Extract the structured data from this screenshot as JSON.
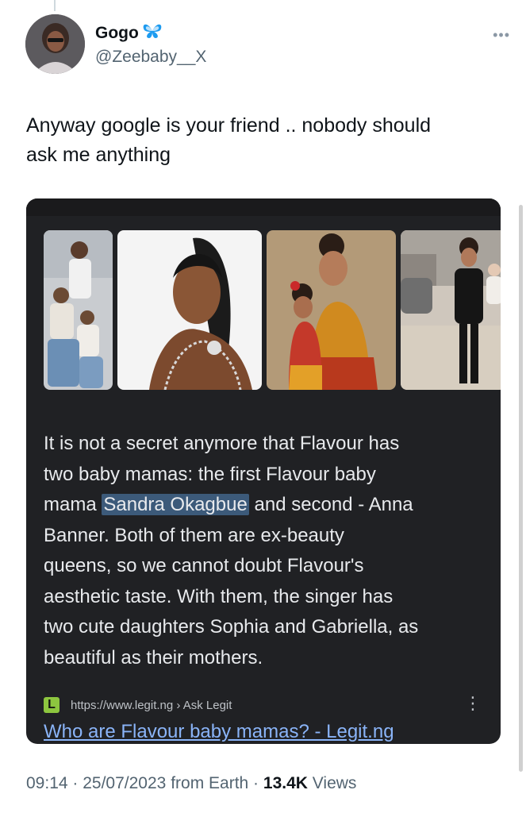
{
  "author": {
    "display_name": "Gogo",
    "badge_icon": "butterfly-icon",
    "handle": "@Zeebaby__X"
  },
  "tweet": {
    "text_line1": "Anyway google is your friend .. nobody should",
    "text_line2": "ask me anything"
  },
  "card": {
    "snippet_lines": [
      "It is not a secret anymore that Flavour has",
      "two baby mamas: the first Flavour baby",
      "Banner. Both of them are ex-beauty",
      "queens, so we cannot doubt Flavour's",
      "aesthetic taste. With them, the singer has",
      "two cute daughters Sophia and Gabriella, as",
      "beautiful as their mothers."
    ],
    "snippet_line3_pre": "mama ",
    "snippet_highlight": "Sandra Okagbue",
    "snippet_line3_post": " and second - Anna",
    "favicon_letter": "L",
    "source_url": "https://www.legit.ng › Ask Legit",
    "result_title": "Who are Flavour baby mamas? - Legit.ng"
  },
  "footer": {
    "time": "09:14",
    "date": "25/07/2023",
    "source": "from Earth",
    "sep": " · ",
    "views_count": "13.4K",
    "views_label": " Views"
  },
  "colors": {
    "card_bg": "#202124",
    "link": "#8ab4f8",
    "highlight": "#3c5a7a",
    "badge": "#1d9bf0"
  }
}
